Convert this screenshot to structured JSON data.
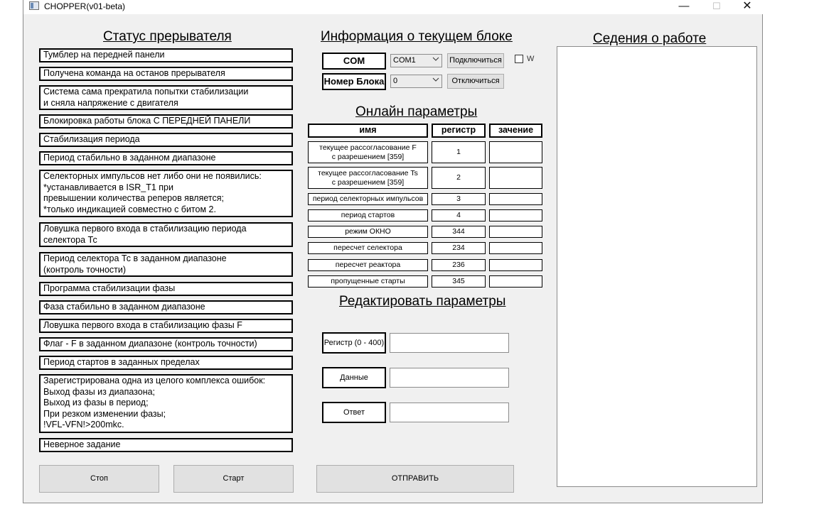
{
  "window": {
    "title": "CHOPPER(v01-beta)",
    "minimize": "—",
    "maximize": "☐",
    "close": "✕"
  },
  "status_panel": {
    "heading": "Статус прерывателя",
    "items": [
      "Тумблер на передней панели",
      "Получена команда на останов прерывателя",
      "Система сама  прекратила попытки стабилизации\nи сняла напряжение с двигателя",
      "Блокировка работы блока С ПЕРЕДНЕЙ ПАНЕЛИ",
      "Стабилизация периода",
      "Период стабильно в заданном диапазоне",
      "Селекторных импульсов нет либо они не появились:\n*устанавливается в ISR_T1 при\n превышении количества реперов является;\n*только индикацией совместно с битом 2.",
      "Ловушка первого входа в  стабилизацию периода\nселектора Тс",
      "Период селектора Тс в заданном диапазоне\n(контроль точности)",
      "Программа стабилизации фазы",
      "Фаза   стабильно в заданном диапазоне",
      "Ловушка первого входа в  стабилизацию фазы  F",
      "Флаг - F в заданном диапазоне (контроль точности)",
      "Период стартов в заданных пределах",
      "Зарегистрирована одна из целого комплекса ошибок:\nВыход  фазы из диапазона;\nВыход  из фазы в период;\nПри резком изменении фазы;\n!VFL-VFN!>200mkc.",
      "Неверное задание"
    ],
    "stop_button": "Стоп",
    "start_button": "Старт"
  },
  "block_info": {
    "heading": "Информация о текущем блоке",
    "com_label": "COM",
    "com_value": "COM1",
    "block_label": "Номер Блока",
    "block_value": "0",
    "connect_button": "Подключиться",
    "disconnect_button": "Отключиться",
    "w_label": "W"
  },
  "online_params": {
    "heading": "Онлайн параметры",
    "columns": [
      "имя",
      "регистр",
      "зачение"
    ],
    "rows": [
      {
        "name": "текущее рассогласование F\nс разрешением [359]",
        "register": "1",
        "value": ""
      },
      {
        "name": "текущее рассогласование Ts\nс разрешением [359]",
        "register": "2",
        "value": ""
      },
      {
        "name": "период селекторных импульсов",
        "register": "3",
        "value": ""
      },
      {
        "name": "период стартов",
        "register": "4",
        "value": ""
      },
      {
        "name": "режим ОКНО",
        "register": "344",
        "value": ""
      },
      {
        "name": "пересчет селектора",
        "register": "234",
        "value": ""
      },
      {
        "name": "пересчет реактора",
        "register": "236",
        "value": ""
      },
      {
        "name": "пропущенные старты",
        "register": "345",
        "value": ""
      }
    ]
  },
  "edit_params": {
    "heading": "Редактировать параметры",
    "register_label": "Регистр (0 - 400)",
    "register_value": "",
    "data_label": "Данные",
    "data_value": "",
    "answer_label": "Ответ",
    "answer_value": "",
    "send_button": "ОТПРАВИТЬ"
  },
  "log_panel": {
    "heading": "Седения о работе",
    "content": ""
  }
}
